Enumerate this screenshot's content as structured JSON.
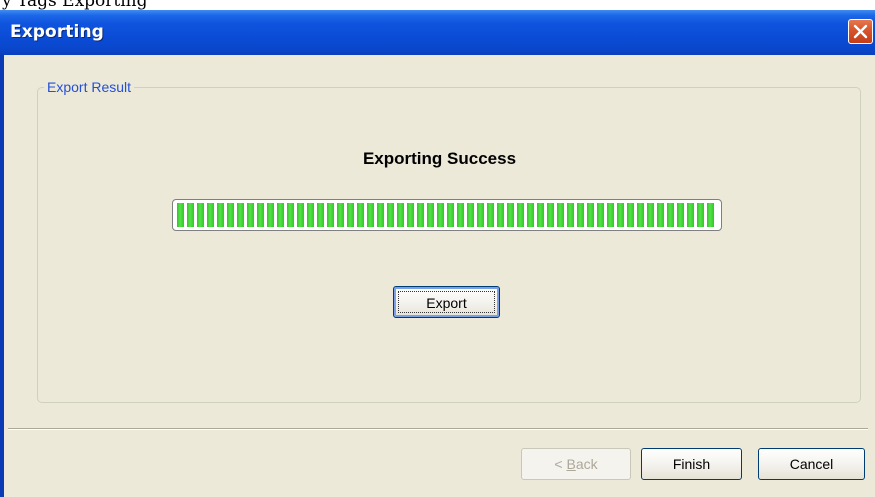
{
  "window": {
    "title": "Exporting"
  },
  "background": {
    "partial_text": "y Tags Exporting"
  },
  "group": {
    "label": "Export Result"
  },
  "status": {
    "text": "Exporting Success"
  },
  "progress": {
    "percent": 100,
    "color": "#2fc823"
  },
  "buttons": {
    "export": "Export",
    "back_prefix": "< ",
    "back_mnemonic": "B",
    "back_rest": "ack",
    "finish": "Finish",
    "cancel": "Cancel"
  },
  "icons": {
    "close": "close-icon"
  },
  "colors": {
    "titlebar": "#0f54de",
    "close": "#d8532a",
    "client": "#ece9d8",
    "group_label": "#2450d8"
  }
}
